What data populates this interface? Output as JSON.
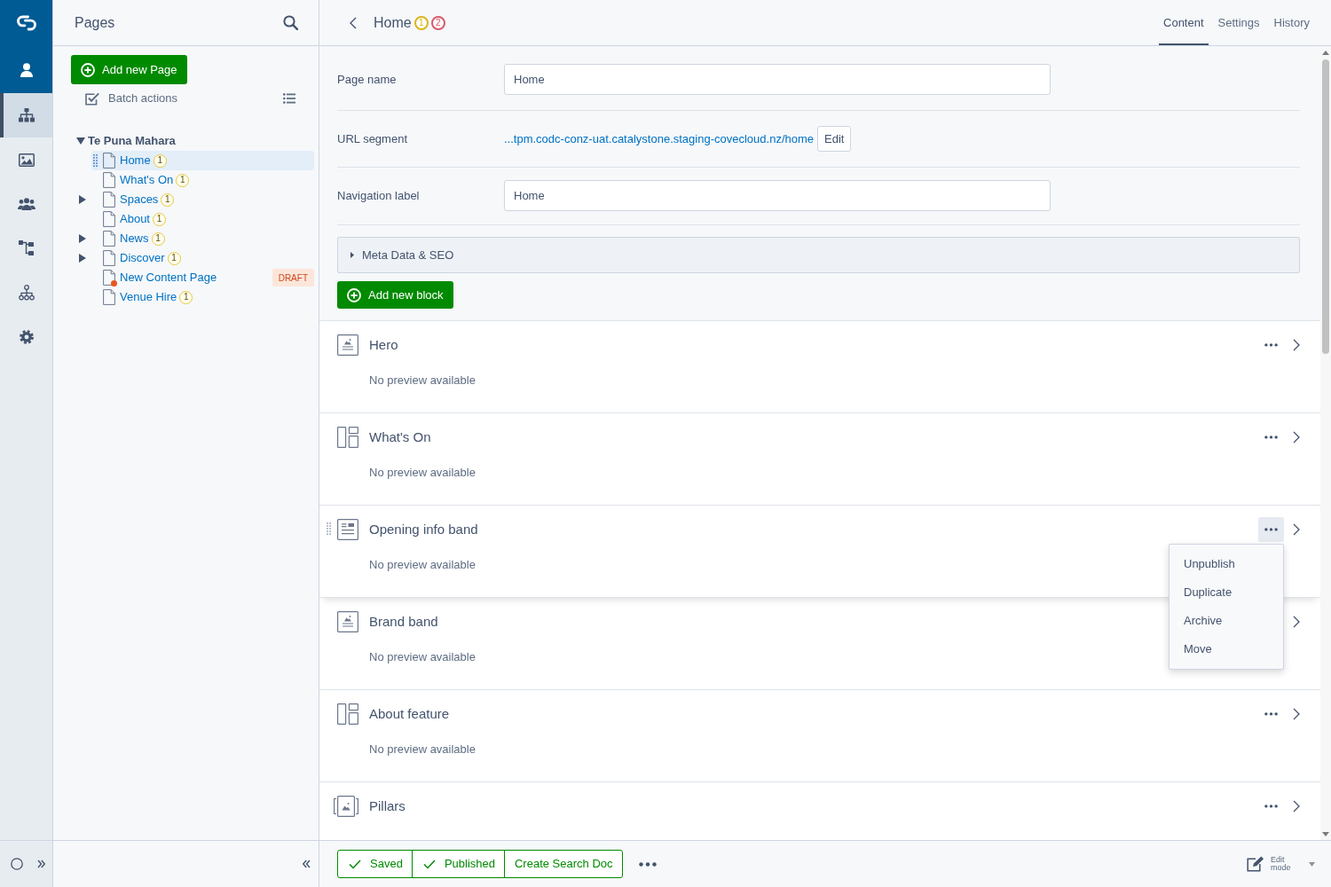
{
  "rail": {
    "items": [
      {
        "selected": true
      },
      {
        "selected": false
      },
      {
        "selected": false
      },
      {
        "selected": false
      },
      {
        "selected": false
      },
      {
        "selected": false
      }
    ]
  },
  "pages_panel": {
    "title": "Pages",
    "add_button": "Add new Page",
    "batch_actions": "Batch actions",
    "tree": [
      {
        "label": "Te Puna Mahara",
        "expanded": true,
        "selected": false,
        "children": [
          {
            "label": "Home",
            "badge": "1",
            "selected": true,
            "draft": false
          },
          {
            "label": "What's On",
            "badge": "1",
            "selected": false,
            "draft": false
          },
          {
            "label": "Spaces",
            "badge": "1",
            "expanded": false,
            "selected": false,
            "draft": false
          },
          {
            "label": "About",
            "badge": "1",
            "selected": false,
            "draft": false
          },
          {
            "label": "News",
            "badge": "1",
            "expanded": false,
            "selected": false,
            "draft": false
          },
          {
            "label": "Discover",
            "badge": "1",
            "expanded": false,
            "selected": false,
            "draft": false
          },
          {
            "label": "New Content Page",
            "tag": "DRAFT",
            "selected": false,
            "draft": true
          },
          {
            "label": "Venue Hire",
            "badge": "1",
            "selected": false,
            "draft": false
          }
        ]
      }
    ]
  },
  "page_header": {
    "title": "Home",
    "badges": [
      {
        "text": "1",
        "color": "#d9b61a"
      },
      {
        "text": "2",
        "color": "#d9596b"
      }
    ],
    "tabs": [
      {
        "label": "Content",
        "selected": true
      },
      {
        "label": "Settings",
        "selected": false
      },
      {
        "label": "History",
        "selected": false
      }
    ]
  },
  "form": {
    "fields": [
      {
        "kind": "input",
        "label": "Page name",
        "value": "Home"
      },
      {
        "kind": "link",
        "label": "URL segment",
        "value": "...tpm.codc-conz-uat.catalystone.staging-covecloud.nz/home",
        "button": "Edit"
      },
      {
        "kind": "input",
        "label": "Navigation label",
        "value": "Home"
      }
    ],
    "meta_panel": {
      "title": "Meta Data & SEO",
      "expanded": false
    },
    "add_block_button": "Add new block"
  },
  "blocks": [
    {
      "kind": "banner",
      "title": "Hero",
      "preview": "No preview available",
      "menu_open": false
    },
    {
      "kind": "columns",
      "title": "What's On",
      "preview": "No preview available",
      "menu_open": false
    },
    {
      "kind": "text",
      "title": "Opening info band",
      "preview": "No preview available",
      "menu_open": true
    },
    {
      "kind": "banner",
      "title": "Brand band",
      "preview": "No preview available",
      "menu_open": false
    },
    {
      "kind": "columns",
      "title": "About feature",
      "preview": "No preview available",
      "menu_open": false
    },
    {
      "kind": "carousel",
      "title": "Pillars",
      "menu_open": false
    }
  ],
  "block_menu": {
    "items": [
      "Unpublish",
      "Duplicate",
      "Archive",
      "Move"
    ]
  },
  "footer": {
    "buttons": [
      {
        "label": "Saved",
        "done": true
      },
      {
        "label": "Published",
        "done": true
      },
      {
        "label": "Create Search Doc",
        "done": false
      }
    ],
    "edit_mode": "Edit mode"
  }
}
